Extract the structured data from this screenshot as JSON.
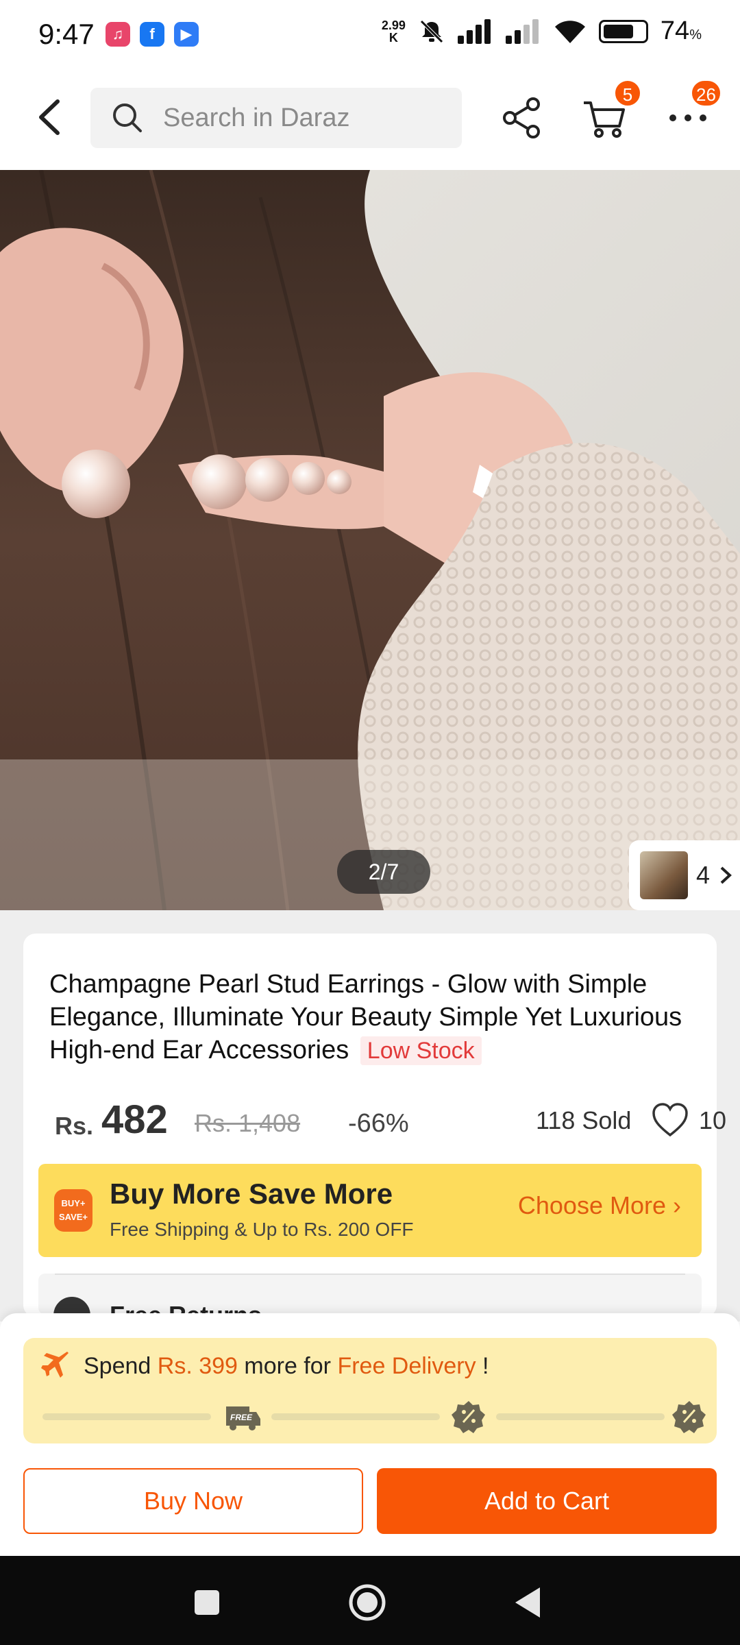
{
  "status_bar": {
    "time": "9:47",
    "net_speed_value": "2.99",
    "net_speed_unit": "K",
    "battery_percent": "74",
    "battery_symbol": "%"
  },
  "header": {
    "search_placeholder": "Search in Daraz",
    "cart_badge": "5",
    "more_badge": "26"
  },
  "gallery": {
    "page_indicator": "2/7",
    "variant_count": "4"
  },
  "product": {
    "title": "Champagne Pearl Stud Earrings - Glow with Simple Elegance, Illuminate Your Beauty Simple Yet Luxurious High-end Ear Accessories",
    "stock_tag": "Low Stock",
    "currency": "Rs.",
    "price": "482",
    "original_price": "Rs. 1,408",
    "discount": "-66%",
    "sold": "118 Sold",
    "wishlist_count": "10"
  },
  "promo": {
    "logo_text_top": "BUY+",
    "logo_text_bottom": "SAVE+",
    "title": "Buy More Save More",
    "subtitle": "Free Shipping & Up to Rs. 200 OFF",
    "link": "Choose More"
  },
  "free_return": {
    "label": "Free Returns"
  },
  "delivery": {
    "prefix": "Spend ",
    "amount": "Rs. 399",
    "middle": " more for ",
    "highlight": "Free Delivery",
    "suffix": " !",
    "milestone_free_label": "FREE",
    "progress": 0
  },
  "actions": {
    "buy_now": "Buy Now",
    "add_to_cart": "Add to Cart"
  },
  "colors": {
    "brand_orange": "#f85606",
    "promo_yellow": "#fddc5c",
    "delivery_bg": "#fdeeb0",
    "low_stock_red": "#e23a3a"
  }
}
